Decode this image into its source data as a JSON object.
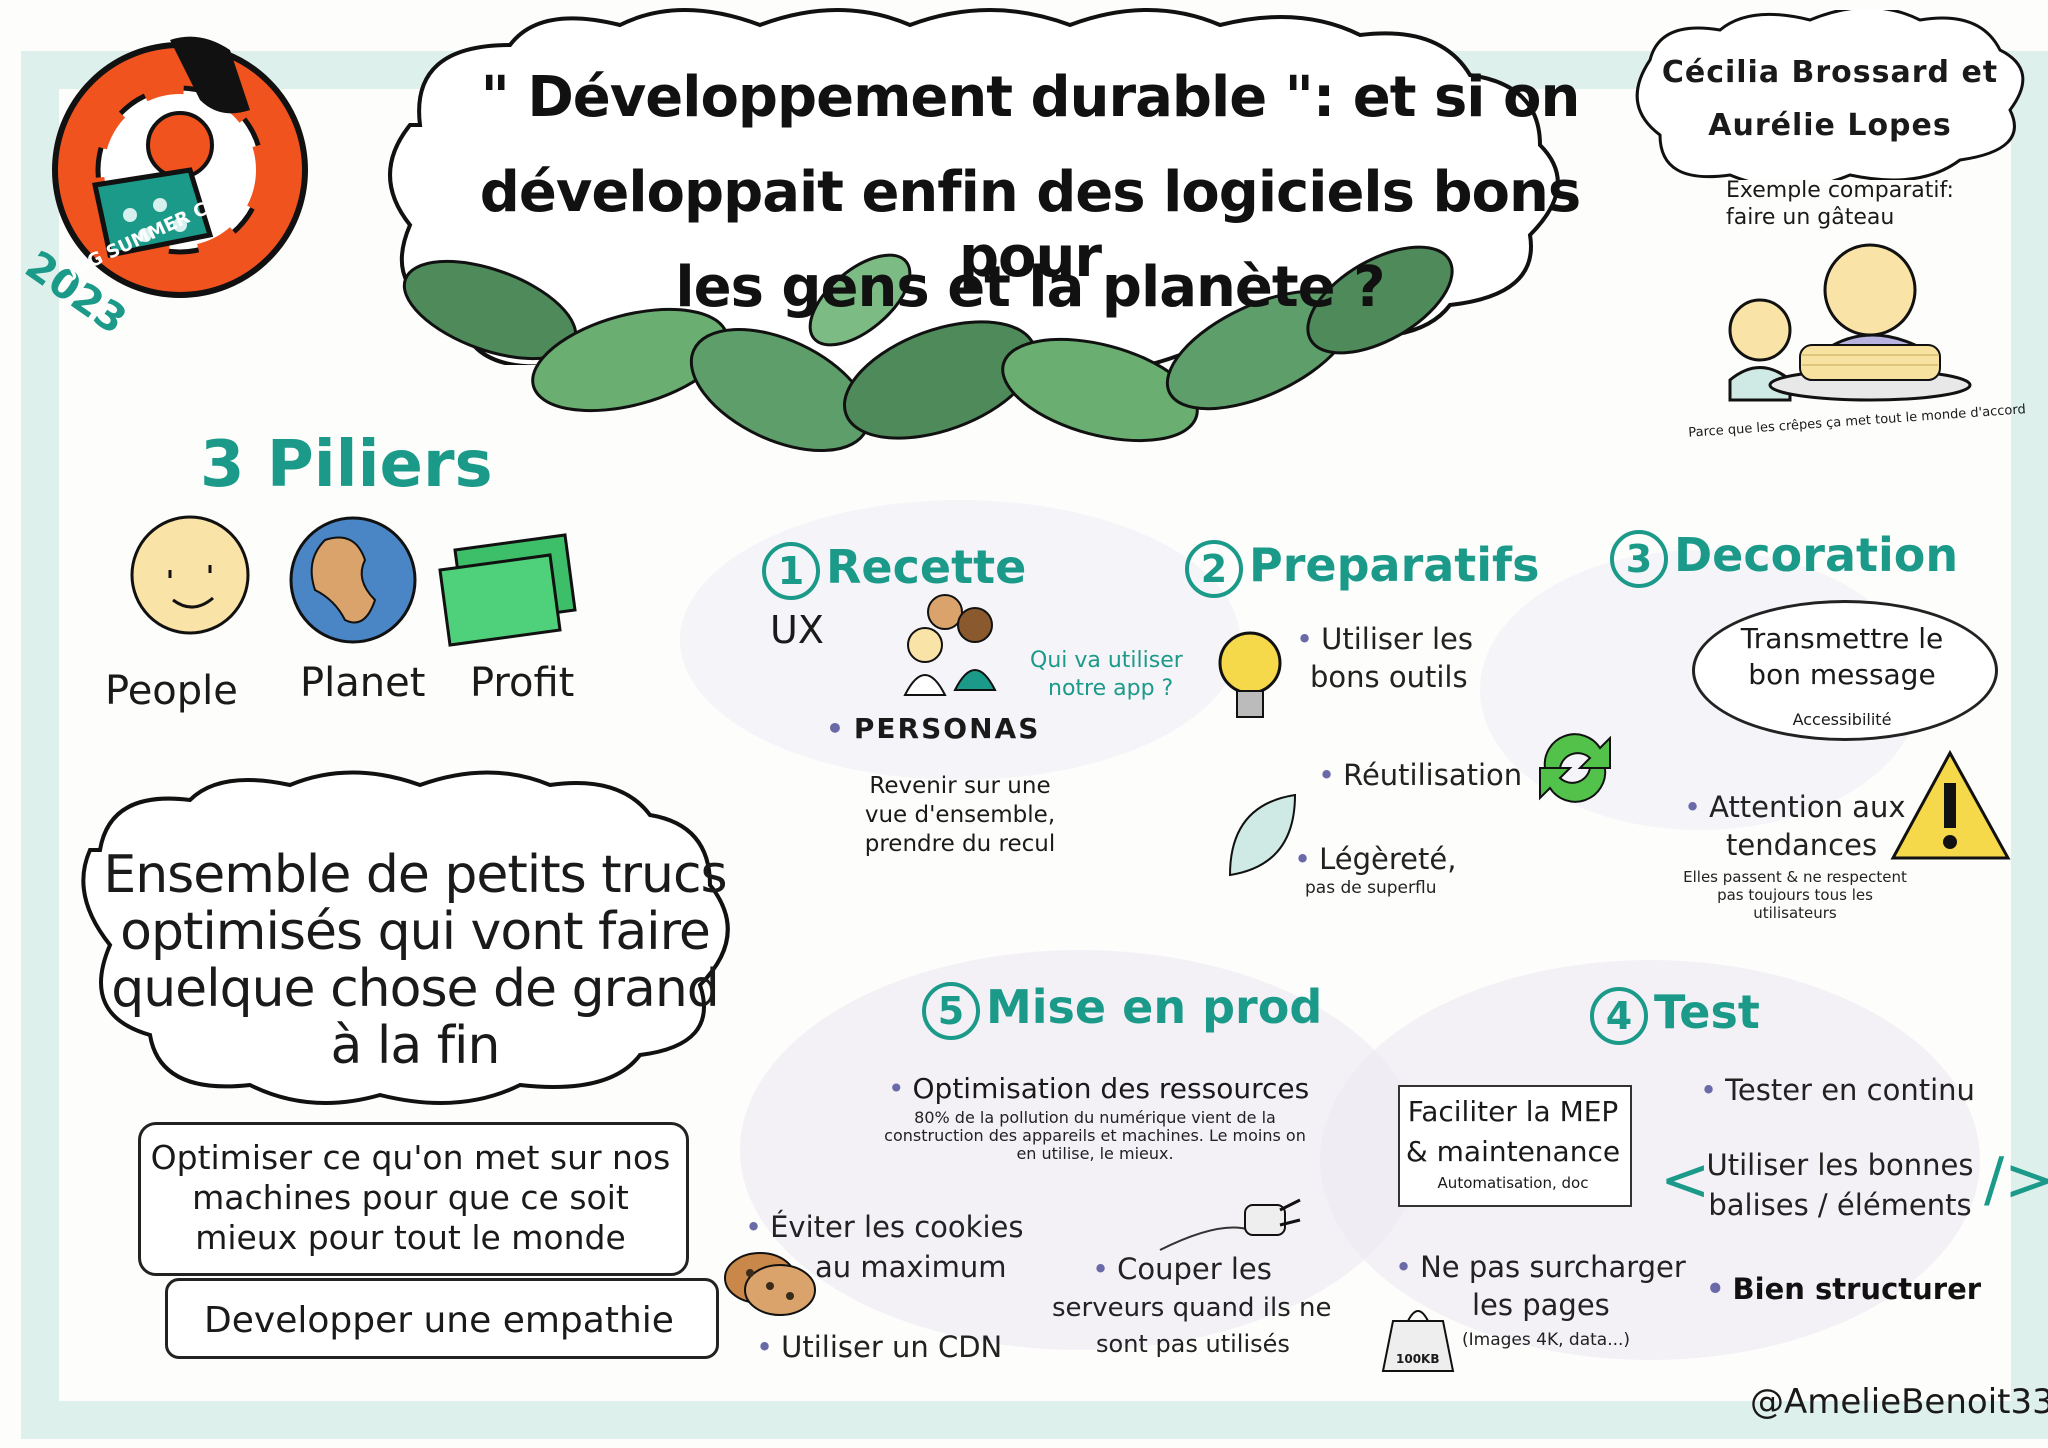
{
  "logo": {
    "text": "JUG SUMMER CAMP",
    "year": "2023"
  },
  "title": {
    "line1": "\" Développement durable \": et si on",
    "line2": "développait enfin des logiciels bons pour",
    "line3": "les gens et la planète ?"
  },
  "authors": {
    "line1": "Cécilia Brossard et",
    "line2": "Aurélie Lopes"
  },
  "example": {
    "heading_line1": "Exemple comparatif:",
    "heading_line2": "faire un gâteau",
    "caption": "Parce que les crêpes ça met tout le monde d'accord"
  },
  "pillars": {
    "title": "3 Piliers",
    "items": [
      {
        "label": "People"
      },
      {
        "label": "Planet"
      },
      {
        "label": "Profit"
      }
    ]
  },
  "cloud": {
    "line1": "Ensemble de petits trucs",
    "line2": "optimisés qui vont faire",
    "line3": "quelque chose de grand",
    "line4": "à la fin"
  },
  "bubble1": {
    "line1": "Optimiser ce qu'on met sur nos",
    "line2": "machines pour que ce soit",
    "line3": "mieux pour tout le monde"
  },
  "bubble2": {
    "text": "Developper une empathie"
  },
  "sections": {
    "recette": {
      "num": "1",
      "title": "Recette",
      "ux": "UX",
      "question_line1": "Qui va utiliser",
      "question_line2": "notre app ?",
      "personas": "PERSONAS",
      "desc_line1": "Revenir sur une",
      "desc_line2": "vue d'ensemble,",
      "desc_line3": "prendre du recul"
    },
    "preparatifs": {
      "num": "2",
      "title": "Preparatifs",
      "item1_line1": "Utiliser les",
      "item1_line2": "bons outils",
      "item2": "Réutilisation",
      "item3": "Légèreté,",
      "item3_sub": "pas de superflu"
    },
    "decoration": {
      "num": "3",
      "title": "Decoration",
      "bubble_line1": "Transmettre le",
      "bubble_line2": "bon message",
      "bubble_sub": "Accessibilité",
      "attention_line1": "Attention aux",
      "attention_line2": "tendances",
      "attention_sub_line1": "Elles passent & ne respectent",
      "attention_sub_line2": "pas toujours tous les",
      "attention_sub_line3": "utilisateurs"
    },
    "test": {
      "num": "4",
      "title": "Test",
      "item1": "Tester en continu",
      "item2_line1": "Utiliser les bonnes",
      "item2_line2": "balises / éléments",
      "item3": "Bien structurer",
      "note_line1": "Faciliter la MEP",
      "note_line2": "& maintenance",
      "note_sub": "Automatisation, doc",
      "pages_line1": "Ne pas surcharger",
      "pages_line2": "les pages",
      "pages_sub": "(Images 4K, data...)",
      "weight": "100KB"
    },
    "prod": {
      "num": "5",
      "title": "Mise en prod",
      "item1": "Optimisation des ressources",
      "item1_sub_line1": "80% de la pollution du numérique vient de la",
      "item1_sub_line2": "construction des appareils et machines. Le moins on",
      "item1_sub_line3": "en utilise, le mieux.",
      "cookies_line1": "Éviter les cookies",
      "cookies_line2": "au maximum",
      "cdn": "Utiliser un CDN",
      "servers_line1": "Couper les",
      "servers_line2": "serveurs quand ils ne",
      "servers_line3": "sont pas utilisés"
    }
  },
  "signature": "@AmelieBenoit33",
  "colors": {
    "teal": "#1b9a8a",
    "orange": "#f0531e",
    "leaf": "#5e9e6a",
    "bullet": "#6a6aa8"
  }
}
